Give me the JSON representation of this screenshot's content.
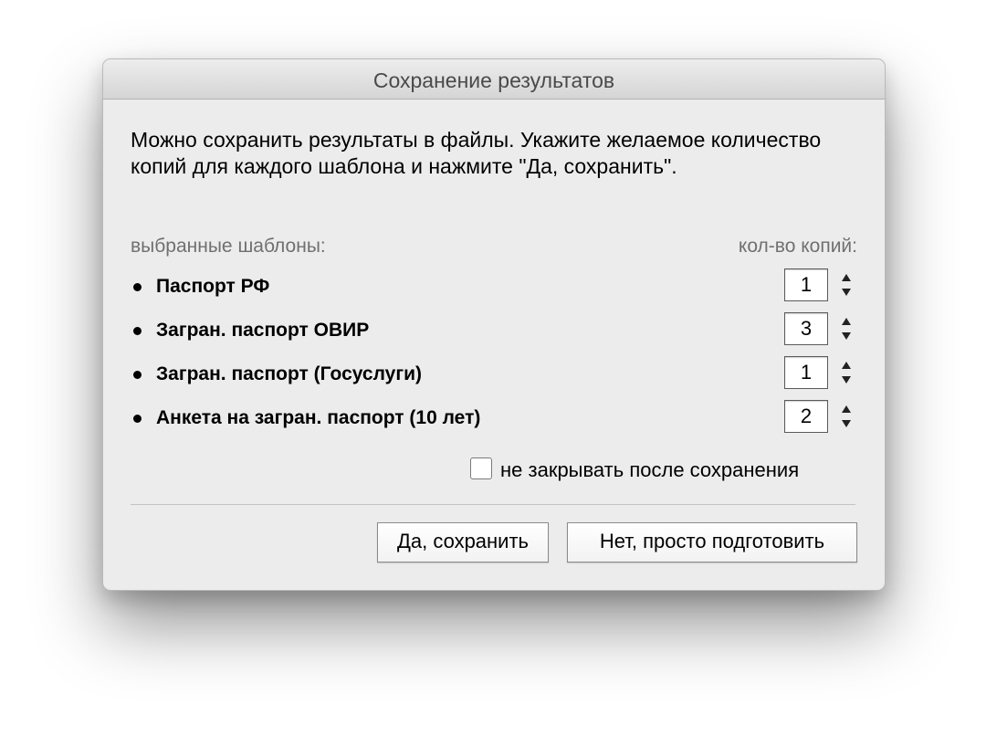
{
  "dialog": {
    "title": "Сохранение результатов",
    "intro_text": "Можно сохранить результаты в файлы. Укажите желаемое количество копий для каждого шаблона и нажмите \"Да, сохранить\".",
    "header_left": "выбранные шаблоны:",
    "header_right": "кол-во копий:",
    "templates": [
      {
        "label": "Паспорт РФ",
        "copies": "1"
      },
      {
        "label": "Загран. паспорт ОВИР",
        "copies": "3"
      },
      {
        "label": "Загран. паспорт (Госуслуги)",
        "copies": "1"
      },
      {
        "label": "Анкета на загран. паспорт (10 лет)",
        "copies": "2"
      }
    ],
    "keep_open": {
      "label": "не закрывать после сохранения",
      "checked": false
    },
    "buttons": {
      "yes": "Да, сохранить",
      "no": "Нет, просто подготовить"
    }
  }
}
